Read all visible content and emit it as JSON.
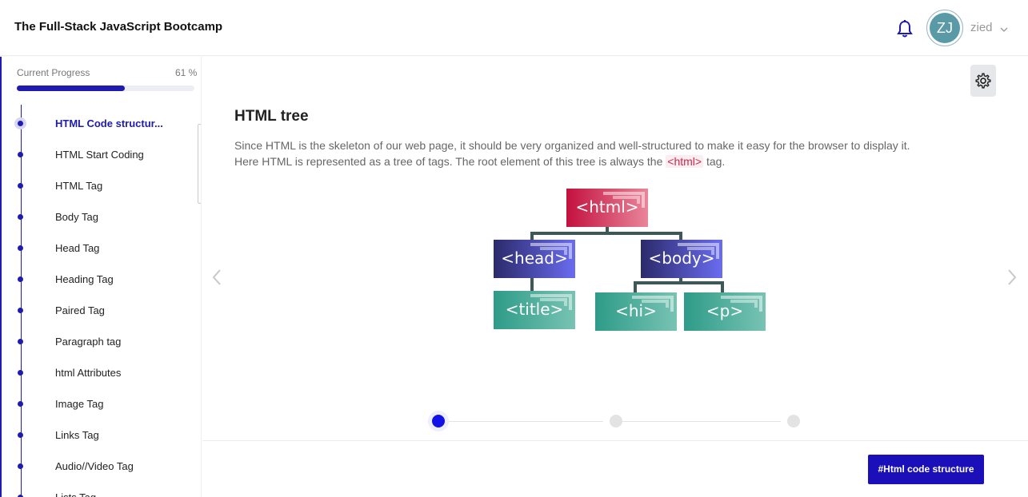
{
  "header": {
    "course_title": "The Full-Stack JavaScript Bootcamp",
    "avatar_initials": "ZJ",
    "username": "zied"
  },
  "sidebar": {
    "progress_label": "Current Progress",
    "progress_text": "61 %",
    "progress_value": 0.61,
    "lessons": [
      {
        "label": "HTML Code structur...",
        "active": true
      },
      {
        "label": "HTML Start Coding"
      },
      {
        "label": "HTML Tag"
      },
      {
        "label": "Body Tag"
      },
      {
        "label": "Head Tag"
      },
      {
        "label": "Heading Tag"
      },
      {
        "label": "Paired Tag"
      },
      {
        "label": "Paragraph tag"
      },
      {
        "label": "html Attributes"
      },
      {
        "label": "Image Tag"
      },
      {
        "label": "Links Tag"
      },
      {
        "label": "Audio//Video Tag"
      },
      {
        "label": "Lists Tag"
      }
    ]
  },
  "main": {
    "title": "HTML tree",
    "paragraph_line1": "Since HTML is the skeleton of our web page, it should be very organized and well-structured to make it easy for the browser to display it.",
    "paragraph_line2_before": "Here HTML is represented as a tree of tags. The root element of this tree is always the ",
    "paragraph_code": "<html>",
    "paragraph_line2_after": " tag.",
    "diagram": {
      "root": "<html>",
      "head": "<head>",
      "body": "<body>",
      "title": "<title>",
      "h1": "<hi>",
      "p": "<p>"
    },
    "stepper": {
      "current": 1,
      "total": 3
    }
  },
  "footer": {
    "tag_button": "#Html code structure"
  },
  "colors": {
    "accent": "#1f1bb0",
    "html_node": "#c3113e",
    "purple_node": "#2b2a6b",
    "teal_node": "#2e9b88"
  },
  "icons": [
    "bell-icon",
    "chevron-down-icon",
    "gear-icon",
    "chevron-left-icon",
    "chevron-right-icon"
  ]
}
